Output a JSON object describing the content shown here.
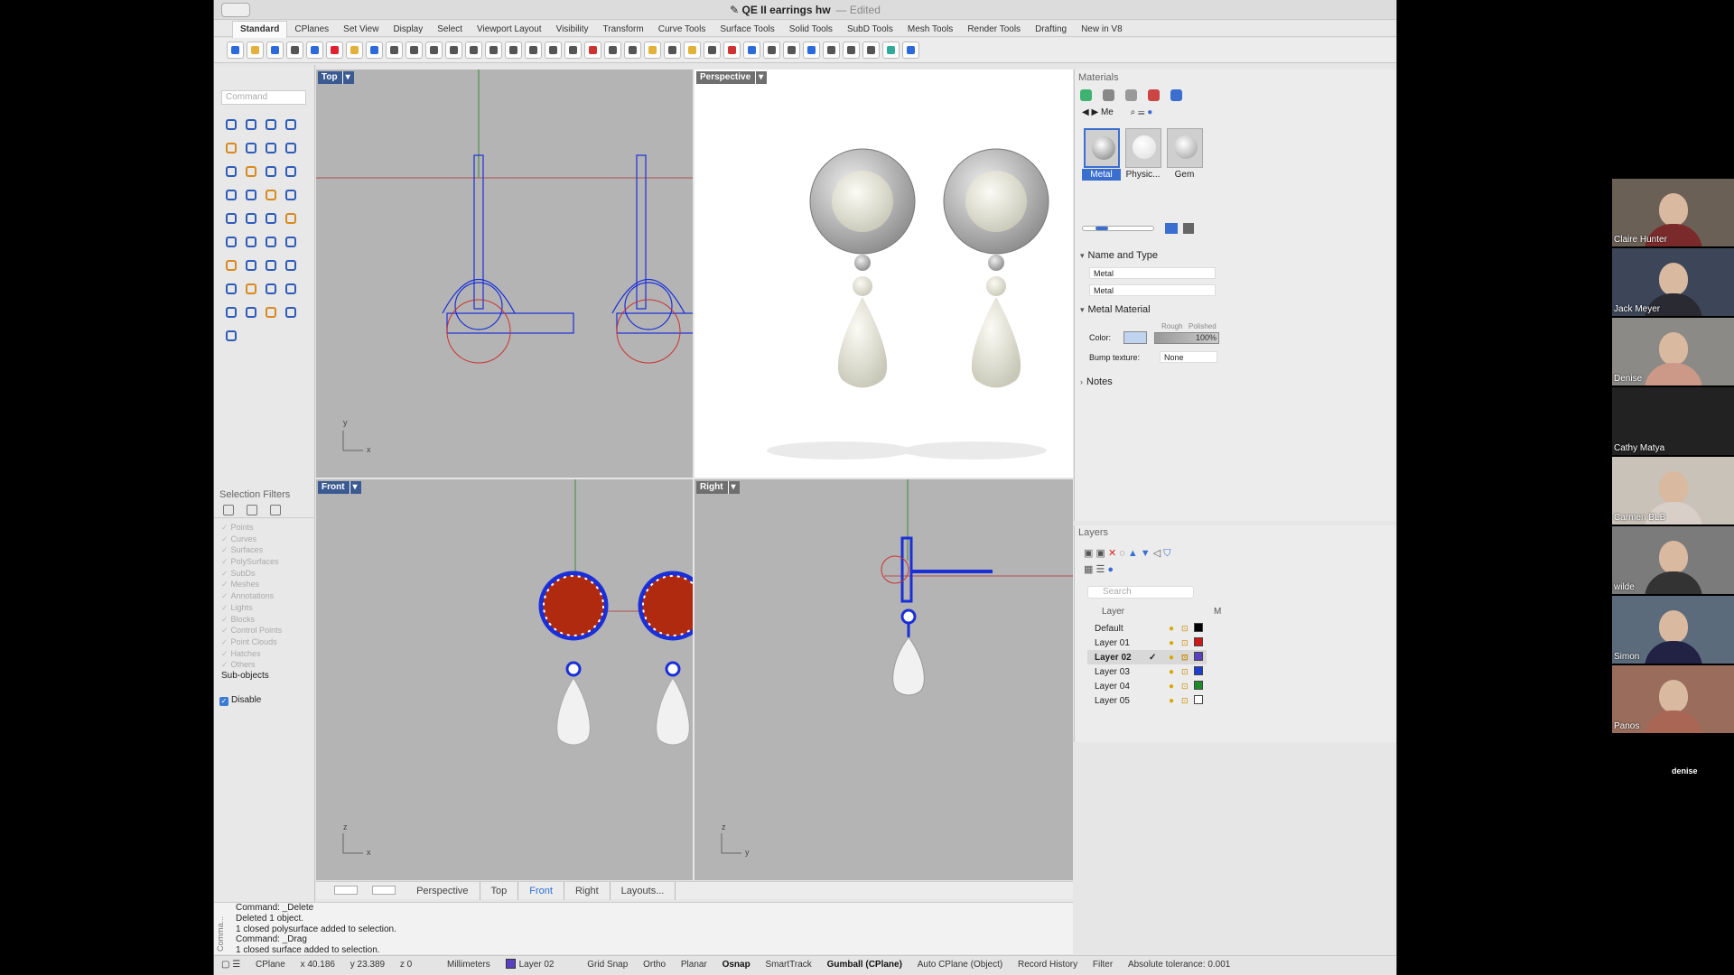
{
  "window": {
    "title": "QE II earrings hw",
    "title_suffix": "— Edited"
  },
  "menu_tabs": [
    "Standard",
    "CPlanes",
    "Set View",
    "Display",
    "Select",
    "Viewport Layout",
    "Visibility",
    "Transform",
    "Curve Tools",
    "Surface Tools",
    "Solid Tools",
    "SubD Tools",
    "Mesh Tools",
    "Render Tools",
    "Drafting",
    "New in V8"
  ],
  "active_menu_tab": "Standard",
  "command": {
    "placeholder": "Command"
  },
  "viewports": {
    "top": "Top",
    "perspective": "Perspective",
    "front": "Front",
    "right": "Right"
  },
  "axis_labels": {
    "top": [
      "y",
      "x"
    ],
    "front": [
      "z",
      "x"
    ],
    "right": [
      "z",
      "y"
    ]
  },
  "viewport_tabs": [
    "Perspective",
    "Top",
    "Front",
    "Right",
    "Layouts..."
  ],
  "active_viewport_tab": "Front",
  "selection_filters": {
    "title": "Selection Filters",
    "items": [
      "Points",
      "Curves",
      "Surfaces",
      "PolySurfaces",
      "SubDs",
      "Meshes",
      "Annotations",
      "Lights",
      "Blocks",
      "Control Points",
      "Point Clouds",
      "Hatches",
      "Others"
    ],
    "sub_objects": "Sub-objects",
    "disable": "Disable"
  },
  "command_history": [
    "Command: _Delete",
    "Deleted 1 object.",
    "1 closed polysurface added to selection.",
    "Command: _Drag",
    "1 closed surface added to selection."
  ],
  "command_history_label": "Comma...",
  "status_bar": {
    "cplane": "CPlane",
    "x": "x 40.186",
    "y": "y 23.389",
    "z": "z 0",
    "units": "Millimeters",
    "layer": "Layer 02",
    "grid_snap": "Grid Snap",
    "ortho": "Ortho",
    "planar": "Planar",
    "osnap": "Osnap",
    "smarttrack": "SmartTrack",
    "gumball": "Gumball (CPlane)",
    "autocplane": "Auto CPlane (Object)",
    "record": "Record History",
    "filter": "Filter",
    "tolerance": "Absolute tolerance: 0.001"
  },
  "materials": {
    "title": "Materials",
    "current_short": "Me",
    "thumbnails": [
      "Metal",
      "Physic...",
      "Gem"
    ],
    "selected": "Metal",
    "name_and_type": "Name and Type",
    "name_value": "Metal",
    "type_value": "Metal",
    "metal_material": "Metal Material",
    "color_label": "Color:",
    "rough_label": "Rough",
    "polished_label": "Polished",
    "polish_value": "100%",
    "bump_label": "Bump texture:",
    "bump_value": "None",
    "notes": "Notes"
  },
  "layers": {
    "title": "Layers",
    "search_placeholder": "Search",
    "col_layer": "Layer",
    "col_m": "M",
    "current": "Layer 02",
    "rows": [
      {
        "name": "Default",
        "color": "#000000"
      },
      {
        "name": "Layer 01",
        "color": "#d01818"
      },
      {
        "name": "Layer 02",
        "color": "#5a3fc0"
      },
      {
        "name": "Layer 03",
        "color": "#1c3fd0"
      },
      {
        "name": "Layer 04",
        "color": "#1f8c2a"
      },
      {
        "name": "Layer 05",
        "color": "#ffffff"
      }
    ]
  },
  "participants": [
    "Claire Hunter",
    "Jack Meyer",
    "Denise",
    "Cathy Matya",
    "Carmen BLB",
    "wilde",
    "Simon",
    "Panos",
    "denise"
  ],
  "colors": {
    "accent": "#3a6fd0",
    "viewport_bg": "#b4b4b4",
    "wire": "#1a2fd8",
    "gem": "#b02a10"
  }
}
